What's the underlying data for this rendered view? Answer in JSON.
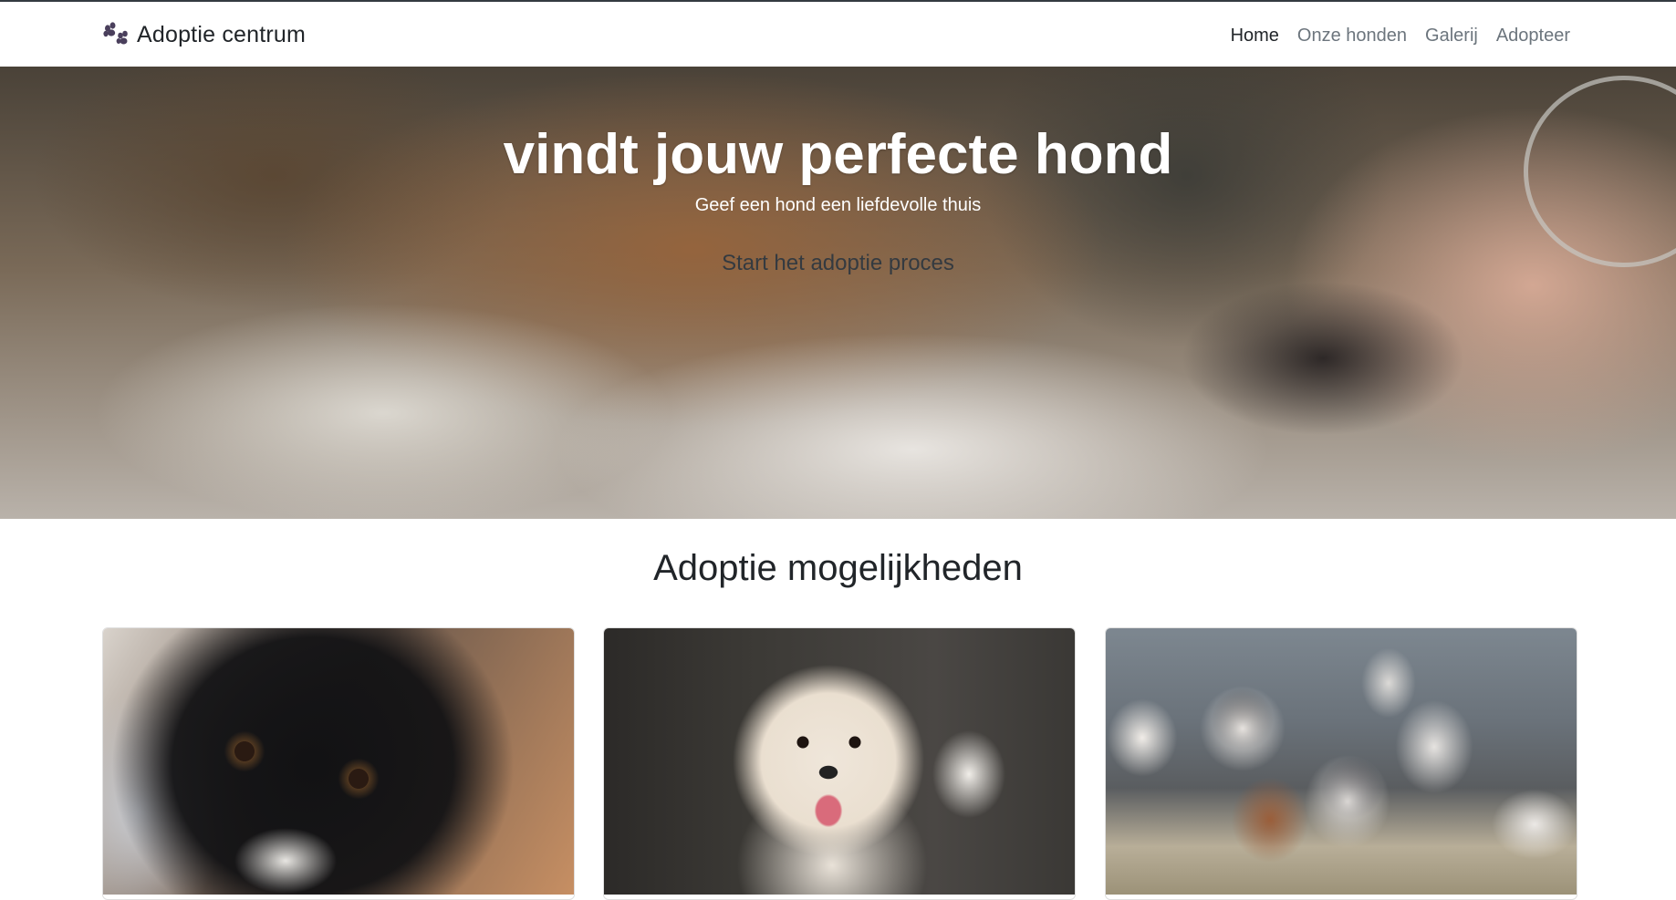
{
  "navbar": {
    "brand": "Adoptie centrum",
    "brand_icon": "paw-icon",
    "items": [
      {
        "label": "Home",
        "active": true
      },
      {
        "label": "Onze honden",
        "active": false
      },
      {
        "label": "Galerij",
        "active": false
      },
      {
        "label": "Adopteer",
        "active": false
      }
    ]
  },
  "hero": {
    "title": "vindt jouw perfecte hond",
    "subtitle": "Geef een hond een liefdevolle thuis",
    "button_label": "Start het adoptie proces"
  },
  "section": {
    "title": "Adoptie mogelijkheden"
  },
  "colors": {
    "text_dark": "#212529",
    "nav_muted": "#6c757d",
    "paw_icon": "#4a3f5c"
  }
}
